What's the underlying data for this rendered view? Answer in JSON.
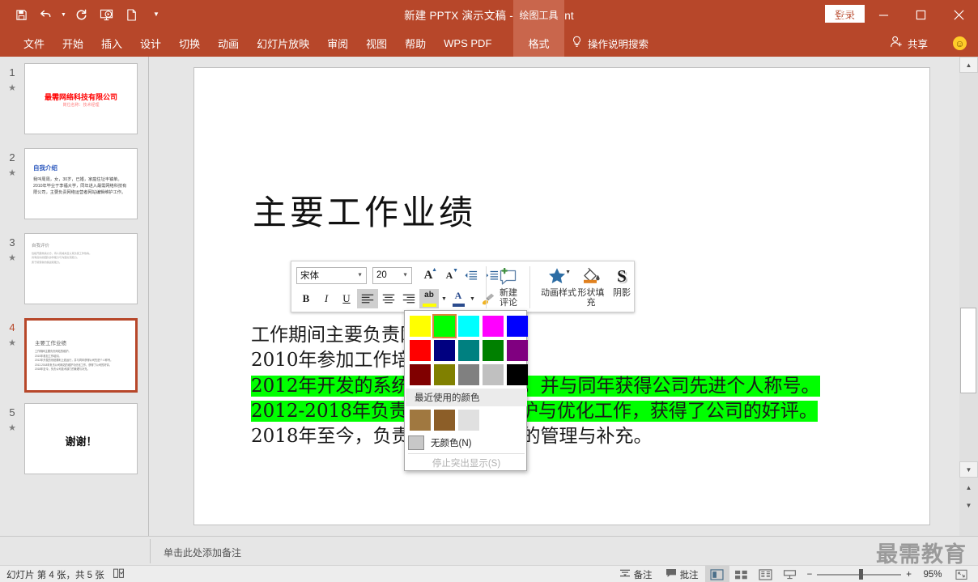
{
  "titlebar": {
    "document_title": "新建 PPTX 演示文稿  -  PowerPoint",
    "context_tab": "绘图工具",
    "signin": "登录",
    "quick_access": [
      {
        "name": "save-icon",
        "label": "保存"
      },
      {
        "name": "undo-icon",
        "label": "撤消"
      },
      {
        "name": "redo-icon",
        "label": "恢复"
      },
      {
        "name": "start-slideshow-icon",
        "label": "从头开始"
      },
      {
        "name": "new-file-icon",
        "label": "新建"
      },
      {
        "name": "customize-qat-icon",
        "label": "自定义快速访问工具栏"
      }
    ],
    "window_controls": [
      {
        "name": "ribbon-display-options-icon",
        "glyph": "⊞"
      },
      {
        "name": "minimize-icon",
        "glyph": "—"
      },
      {
        "name": "maximize-icon",
        "glyph": "☐"
      },
      {
        "name": "close-icon",
        "glyph": "✕"
      }
    ]
  },
  "menubar": {
    "items": [
      "文件",
      "开始",
      "插入",
      "设计",
      "切换",
      "动画",
      "幻灯片放映",
      "审阅",
      "视图",
      "帮助",
      "WPS PDF"
    ],
    "context_tab": "格式",
    "tellme": "操作说明搜索",
    "share": "共享"
  },
  "slides": [
    {
      "number": "1",
      "kind": "title",
      "title": "最需网络科技有限公司",
      "subtitle": "岗位名称：技术经理",
      "selected": false
    },
    {
      "number": "2",
      "kind": "intro",
      "title": "自我介绍",
      "body": "我叫周周，女，30岁，已婚，家庭住址丰镇单。\n2010年毕业于李福大学，同年进入最需网络科技有限公司，主要负责网络运营者网站编辑维护工作。",
      "selected": false
    },
    {
      "number": "3",
      "kind": "eval",
      "title": "自我评价",
      "body": "性格开朗热情大方，待人真诚并且认真负责工作热情。\n具有良好的团队协作能力与沟通交流能力。\n勇于接受新的挑战和能力。",
      "selected": false
    },
    {
      "number": "4",
      "kind": "work",
      "title": "主要工作业绩",
      "body": "工作期间主要负责网站的维护。\n2010年参加工作培训。\n2012年开发的系统顺利上线运行，并与同年获得公司先进个人称号。\n2012-2018年负责公司网站的维护与优化工作，获得了公司的好评。\n2018年至今，负责公司技术部门的管理与补充。",
      "selected": true
    },
    {
      "number": "5",
      "kind": "thanks",
      "title": "谢谢！",
      "selected": false
    }
  ],
  "current_slide": {
    "title": "主要工作业绩",
    "lines": [
      {
        "text": "工作期间主要负责网站的维护。",
        "highlight": false
      },
      {
        "text": "2010年参加工作培训。",
        "highlight": false
      },
      {
        "text": "2012年开发的系统顺利上线运行，并与同年获得公司先进个人称号。",
        "highlight": true
      },
      {
        "text": "2012-2018年负责公司网站的维护与优化工作，获得了公司的好评。",
        "highlight": true
      },
      {
        "text": "2018年至今，负责公司技术部门的管理与补充。",
        "highlight": false
      }
    ],
    "highlight_color": "#00ff00"
  },
  "minibar": {
    "font_name": "宋体",
    "font_size": "20",
    "grow_font": "A",
    "shrink_font": "A",
    "decrease_indent_name": "decrease-indent-icon",
    "increase_indent_name": "increase-indent-icon",
    "bold": "B",
    "italic": "I",
    "underline": "U",
    "align_left_name": "align-left-icon",
    "align_center_name": "align-center-icon",
    "align_right_name": "align-right-icon",
    "highlight_label": "ab",
    "font_color_label": "A",
    "format_painter_name": "format-painter-icon",
    "commands": [
      {
        "name": "new-comment",
        "label": "新建\n评论",
        "line1": "新建",
        "line2": "评论",
        "icon": "comment-icon"
      },
      {
        "name": "animation-styles",
        "label": "动画样式",
        "line1": "动画样式",
        "line2": "",
        "icon": "star-icon"
      },
      {
        "name": "shape-fill",
        "label": "形状填充",
        "line1": "形状填",
        "line2": "充",
        "icon": "fill-bucket-icon"
      },
      {
        "name": "shadow",
        "label": "阴影",
        "line1": "阴影",
        "line2": "",
        "icon": "shadow-s-icon"
      }
    ]
  },
  "color_dropdown": {
    "grid": [
      [
        "#ffff00",
        "#00ff00",
        "#00ffff",
        "#ff00ff",
        "#0000ff"
      ],
      [
        "#ff0000",
        "#000080",
        "#008080",
        "#008000",
        "#800080"
      ],
      [
        "#800000",
        "#808000",
        "#808080",
        "#c0c0c0",
        "#000000"
      ]
    ],
    "selected": "#00ff00",
    "recent_header": "最近使用的颜色",
    "recent": [
      "#a07840",
      "#8c5e28",
      "#e0e0e0"
    ],
    "no_color": "无颜色(N)",
    "stop_highlight": "停止突出显示(S)"
  },
  "notes": {
    "placeholder": "单击此处添加备注",
    "watermark": "最需教育"
  },
  "statusbar": {
    "slide_info": "幻灯片 第 4 张，共 5 张",
    "language_icon": "proofing-icon",
    "notes_button": "备注",
    "comments_button": "批注",
    "views": [
      {
        "name": "normal-view",
        "glyph": "normal",
        "active": true
      },
      {
        "name": "slide-sorter-view",
        "glyph": "sorter",
        "active": false
      },
      {
        "name": "reading-view",
        "glyph": "reading",
        "active": false
      },
      {
        "name": "slideshow-view",
        "glyph": "show",
        "active": false
      }
    ],
    "zoom_out": "−",
    "zoom_in": "+",
    "zoom_value": "95%",
    "fit_slide_name": "fit-to-window-icon"
  },
  "colors": {
    "accent": "#b7472a",
    "accent_light": "#c9664c",
    "highlight_green": "#00ff00",
    "panel_bg": "#e6e6e6",
    "statusbar_bg": "#ededed"
  }
}
